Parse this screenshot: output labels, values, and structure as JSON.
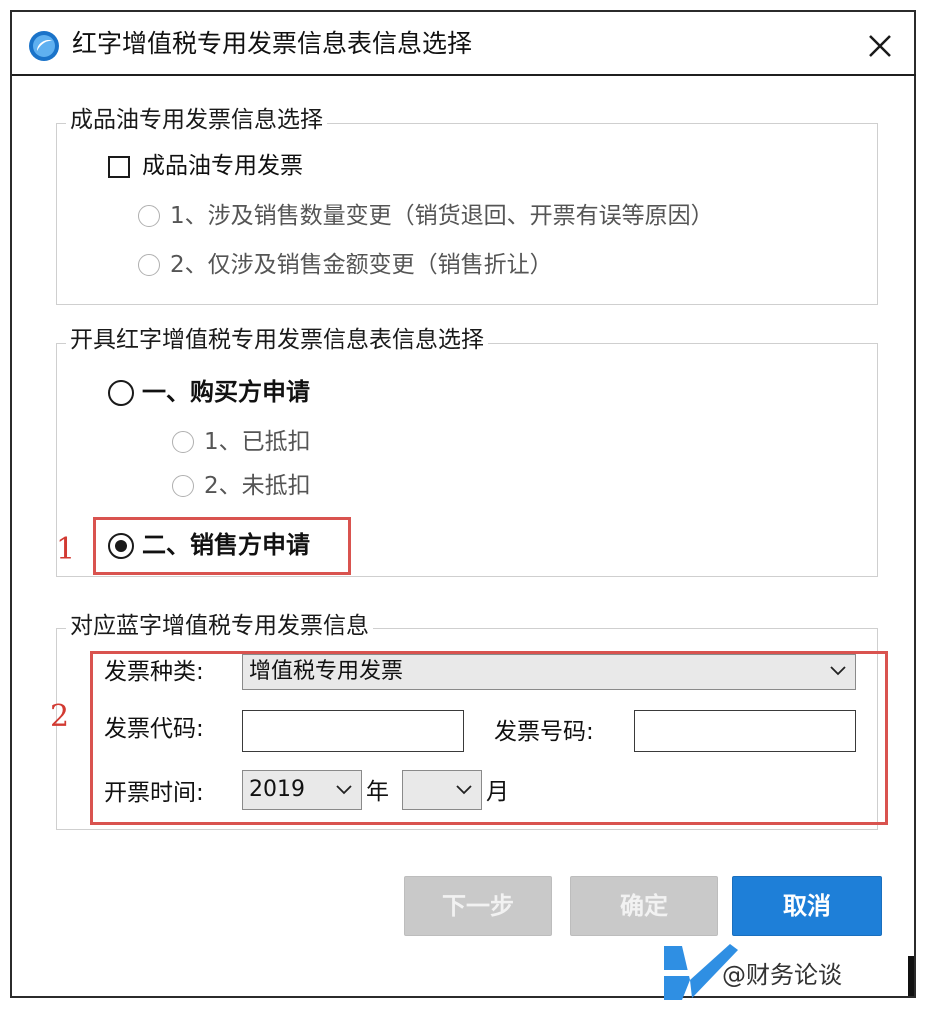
{
  "window": {
    "title": "红字增值税专用发票信息表信息选择"
  },
  "group_oil": {
    "legend": "成品油专用发票信息选择",
    "checkbox_label": "成品油专用发票",
    "option1": "1、涉及销售数量变更（销货退回、开票有误等原因）",
    "option2": "2、仅涉及销售金额变更（销售折让）"
  },
  "group_apply": {
    "legend": "开具红字增值税专用发票信息表信息选择",
    "buyer": "一、购买方申请",
    "buyer_opt1": "1、已抵扣",
    "buyer_opt2": "2、未抵扣",
    "seller": "二、销售方申请",
    "selected": "seller"
  },
  "group_blue": {
    "legend": "对应蓝字增值税专用发票信息",
    "type_label": "发票种类:",
    "type_value": "增值税专用发票",
    "code_label": "发票代码:",
    "code_value": "",
    "number_label": "发票号码:",
    "number_value": "",
    "date_label": "开票时间:",
    "year_value": "2019",
    "year_unit": "年",
    "month_value": "",
    "month_unit": "月"
  },
  "annotations": {
    "one": "1",
    "two": "2"
  },
  "buttons": {
    "next": "下一步",
    "confirm": "确定",
    "cancel": "取消"
  },
  "watermark": {
    "text": "@财务论谈"
  },
  "colors": {
    "primary": "#1e7fd8",
    "annotation": "#d9534f",
    "disabled": "#c9c9c9"
  }
}
